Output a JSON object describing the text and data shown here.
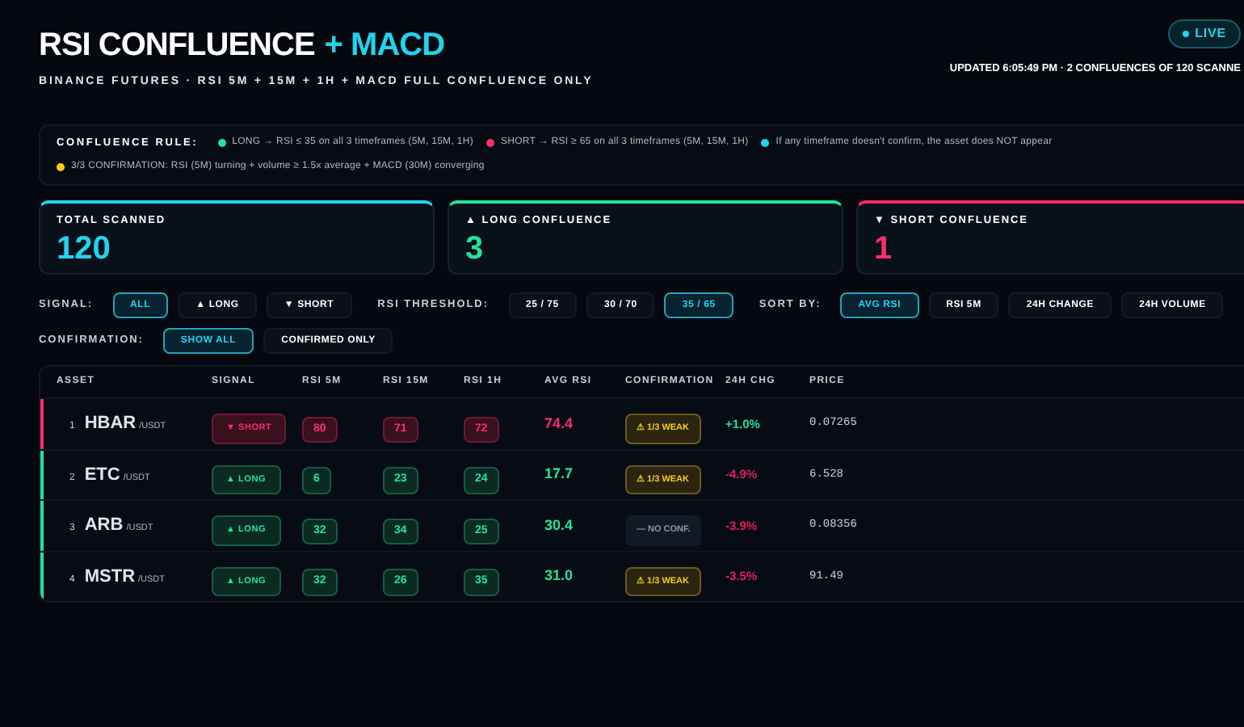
{
  "header": {
    "title_main": "RSI CONFLUENCE",
    "title_plus": "+ MACD",
    "subtitle": "BINANCE FUTURES · RSI 5M + 15M + 1H + MACD FULL CONFLUENCE ONLY",
    "live": "LIVE",
    "updated": "UPDATED 6:05:49 PM · 2 CONFLUENCES OF 120 SCANNE"
  },
  "rule": {
    "label": "CONFLUENCE RULE:",
    "items": [
      {
        "text": "LONG → RSI ≤ 35  on all 3 timeframes (5M, 15M, 1H)",
        "color": "#22e39a"
      },
      {
        "text": "SHORT → RSI ≥ 65  on all 3 timeframes (5M, 15M, 1H)",
        "color": "#ff2d6b"
      },
      {
        "text": "If any timeframe doesn't confirm, the asset does NOT appear",
        "color": "#22d3ee"
      },
      {
        "text": "3/3 CONFIRMATION: RSI (5M) turning + volume ≥ 1.5x average + MACD (30M) converging",
        "color": "#facc15"
      }
    ]
  },
  "cards": [
    {
      "label": "TOTAL SCANNED",
      "value": "120",
      "color": "#22d3ee"
    },
    {
      "label": "▲ LONG CONFLUENCE",
      "value": "3",
      "color": "#22e39a"
    },
    {
      "label": "▼ SHORT CONFLUENCE",
      "value": "1",
      "color": "#ff2d6b"
    }
  ],
  "filters": [
    {
      "groups": [
        {
          "label": "SIGNAL:",
          "options": [
            {
              "label": "ALL",
              "selected": true
            },
            {
              "label": "▲ LONG",
              "selected": false
            },
            {
              "label": "▼ SHORT",
              "selected": false
            }
          ]
        },
        {
          "label": "RSI THRESHOLD:",
          "options": [
            {
              "label": "25 / 75",
              "selected": false
            },
            {
              "label": "30 / 70",
              "selected": false
            },
            {
              "label": "35 / 65",
              "selected": true
            }
          ]
        },
        {
          "label": "SORT BY:",
          "options": [
            {
              "label": "AVG RSI",
              "selected": true
            },
            {
              "label": "RSI 5M",
              "selected": false
            },
            {
              "label": "24H CHANGE",
              "selected": false
            },
            {
              "label": "24H VOLUME",
              "selected": false
            }
          ]
        }
      ]
    },
    {
      "groups": [
        {
          "label": "CONFIRMATION:",
          "options": [
            {
              "label": "SHOW ALL",
              "selected": true
            },
            {
              "label": "CONFIRMED ONLY",
              "selected": false
            }
          ]
        }
      ]
    }
  ],
  "table": {
    "columns": [
      "ASSET",
      "SIGNAL",
      "RSI 5M",
      "RSI 15M",
      "RSI 1H",
      "AVG RSI",
      "CONFIRMATION",
      "24H CHG",
      "PRICE"
    ],
    "rows": [
      {
        "rank": "1",
        "symbol": "HBAR",
        "quote": "/USDT",
        "signal": {
          "kind": "short",
          "label": "▼ SHORT"
        },
        "rsi": [
          "80",
          "71",
          "72"
        ],
        "avg": "74.4",
        "confirmation": {
          "kind": "weak",
          "label": "⚠ 1/3 WEAK"
        },
        "change": {
          "text": "+1.0%",
          "positive": true
        },
        "price": "0.07265"
      },
      {
        "rank": "2",
        "symbol": "ETC",
        "quote": "/USDT",
        "signal": {
          "kind": "long",
          "label": "▲ LONG"
        },
        "rsi": [
          "6",
          "23",
          "24"
        ],
        "avg": "17.7",
        "confirmation": {
          "kind": "weak",
          "label": "⚠ 1/3 WEAK"
        },
        "change": {
          "text": "-4.9%",
          "positive": false
        },
        "price": "6.528"
      },
      {
        "rank": "3",
        "symbol": "ARB",
        "quote": "/USDT",
        "signal": {
          "kind": "long",
          "label": "▲ LONG"
        },
        "rsi": [
          "32",
          "34",
          "25"
        ],
        "avg": "30.4",
        "confirmation": {
          "kind": "none",
          "label": "— NO CONF."
        },
        "change": {
          "text": "-3.9%",
          "positive": false
        },
        "price": "0.08356"
      },
      {
        "rank": "4",
        "symbol": "MSTR",
        "quote": "/USDT",
        "signal": {
          "kind": "long",
          "label": "▲ LONG"
        },
        "rsi": [
          "32",
          "26",
          "35"
        ],
        "avg": "31.0",
        "confirmation": {
          "kind": "weak",
          "label": "⚠ 1/3 WEAK"
        },
        "change": {
          "text": "-3.5%",
          "positive": false
        },
        "price": "91.49"
      }
    ]
  }
}
